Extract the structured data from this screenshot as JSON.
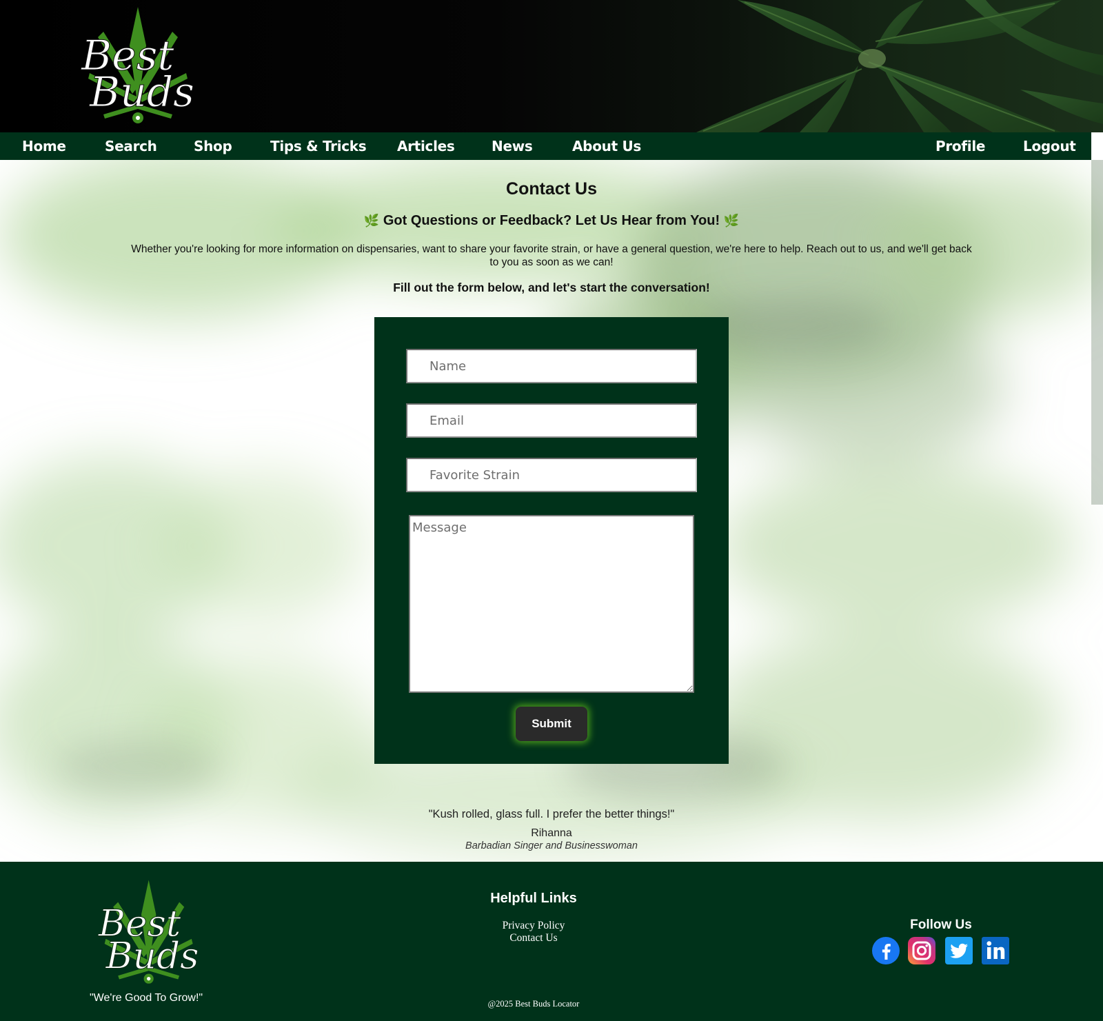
{
  "brand": {
    "logo_text_top": "Best",
    "logo_text_bottom": "Buds",
    "tagline": "\"We're Good To Grow!\""
  },
  "nav": {
    "items": [
      "Home",
      "Search",
      "Shop",
      "Tips & Tricks",
      "Articles",
      "News",
      "About Us"
    ],
    "profile": "Profile",
    "logout": "Logout"
  },
  "page": {
    "title": "Contact Us",
    "subtitle": "Got Questions or Feedback? Let Us Hear from You!",
    "sprig_icon": "🌿",
    "intro": "Whether you're looking for more information on dispensaries, want to share your favorite strain, or have a general question, we're here to help. Reach out to us, and we'll get back to you as soon as we can!",
    "cta": "Fill out the form below, and let's start the conversation!"
  },
  "form": {
    "name_placeholder": "Name",
    "email_placeholder": "Email",
    "strain_placeholder": "Favorite Strain",
    "message_placeholder": "Message",
    "submit_label": "Submit"
  },
  "quote": {
    "text": "\"Kush rolled, glass full. I prefer the better things!\"",
    "author": "Rihanna",
    "role": "Barbadian Singer and Businesswoman"
  },
  "footer": {
    "links_title": "Helpful Links",
    "links": [
      "Privacy Policy",
      "Contact Us"
    ],
    "copyright": "@2025 Best Buds Locator",
    "follow_title": "Follow Us",
    "social": [
      "facebook-icon",
      "instagram-icon",
      "twitter-icon",
      "linkedin-icon"
    ]
  },
  "colors": {
    "nav_bg": "#00321a",
    "form_bg": "#00321a",
    "leaf_green": "#3f8f1f",
    "submit_glow": "#4a9b1c"
  }
}
